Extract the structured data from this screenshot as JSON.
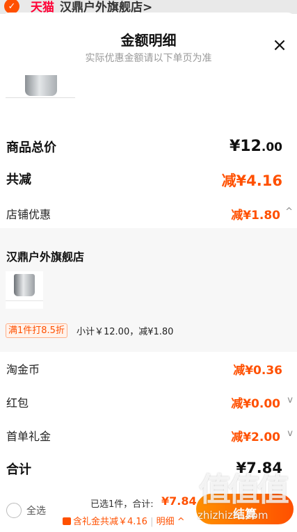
{
  "background": {
    "brand": "天猫",
    "store": "汉鼎户外旗舰店",
    "chevron": ">"
  },
  "header": {
    "title": "金额明细",
    "subtitle": "实际优惠金额请以下单页为准",
    "close_icon": "×"
  },
  "rows": {
    "goods_total": {
      "label": "商品总价",
      "currency": "¥",
      "int": "12",
      "dec": ".00"
    },
    "discount": {
      "label": "共减",
      "value": "减¥4.16"
    },
    "shop": {
      "label": "店铺优惠",
      "value": "减¥1.80",
      "chevron": "^"
    },
    "coin": {
      "label": "淘金币",
      "value": "减¥0.36"
    },
    "red_packet": {
      "label": "红包",
      "value": "减¥0.00",
      "chevron": "v"
    },
    "gift": {
      "label": "首单礼金",
      "value": "减¥2.00",
      "chevron": "v"
    },
    "sum": {
      "label": "合计",
      "currency": "¥",
      "value": "7.84"
    }
  },
  "shop_panel": {
    "name": "汉鼎户外旗舰店",
    "promo_tag": "满1件打8.5折",
    "subtotal": "小计￥12.00，减¥1.80"
  },
  "bottom": {
    "select_all": "全选",
    "picked": "已选1件，合计:",
    "picked_price": "¥7.84",
    "gift_line": "含礼金共减￥4.16",
    "detail": "明细",
    "detail_chevron": "^",
    "checkout": "结算"
  },
  "watermark": {
    "big": "值值值",
    "small": "zhizhizhi.com"
  },
  "colors": {
    "accent": "#ff5000",
    "brand_red": "#ff0036",
    "muted": "#999999",
    "panel": "#f7f7f7"
  }
}
